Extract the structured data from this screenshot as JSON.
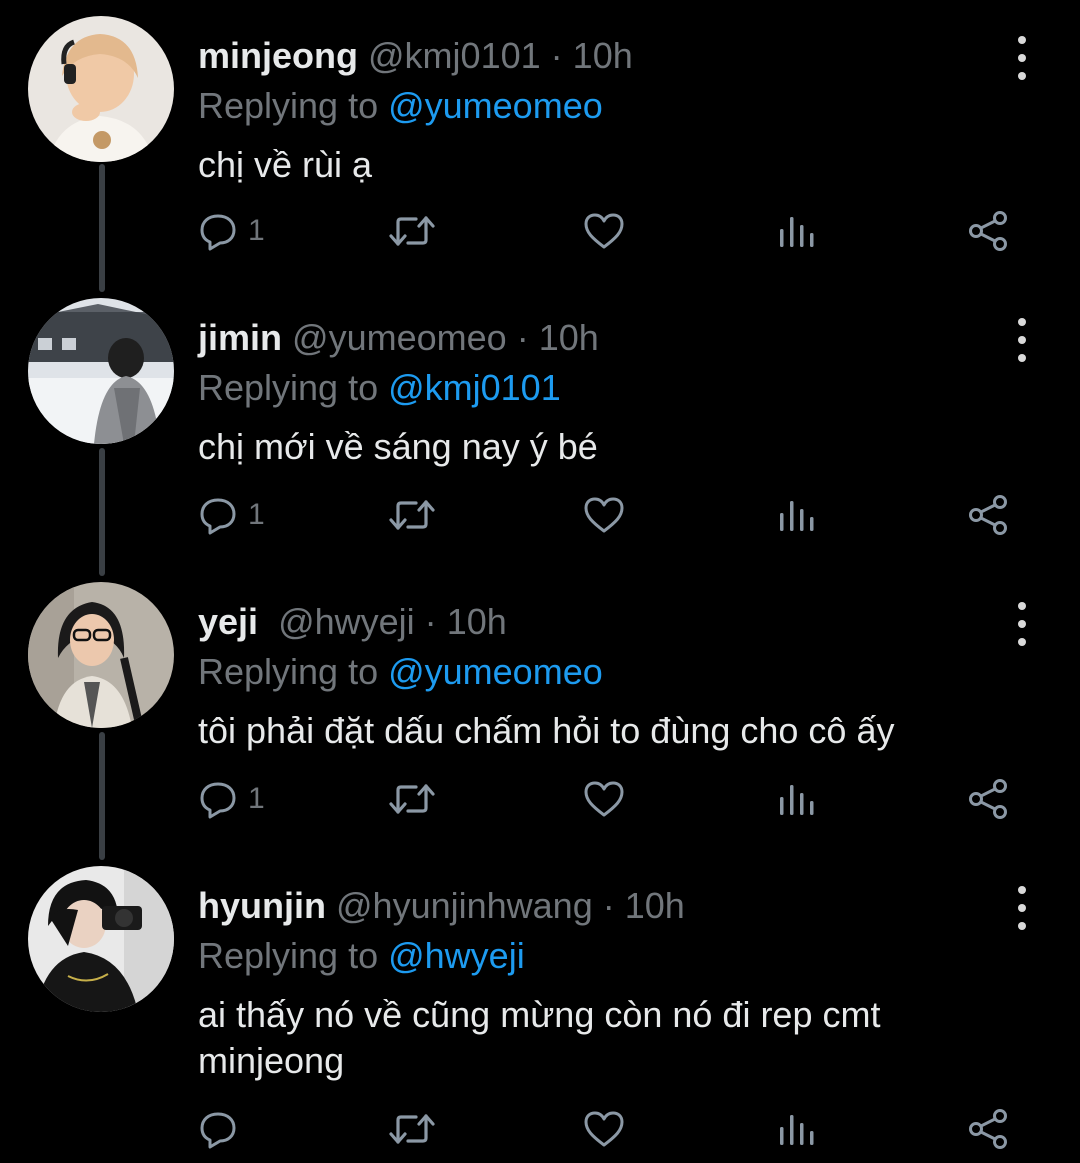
{
  "colors": {
    "background": "#000000",
    "text": "#e7e9ea",
    "muted": "#71767b",
    "accent": "#1d9bf0",
    "thread_line": "#3a3f44"
  },
  "tweets": [
    {
      "name": "minjeong",
      "handle": "@kmj0101",
      "sep": "·",
      "time": "10h",
      "replying_prefix": "Replying to ",
      "replying_to": "@yumeomeo",
      "text": "chị về rùi ạ",
      "reply_count": "1",
      "icons": [
        "reply-icon",
        "retweet-icon",
        "like-icon",
        "views-icon",
        "share-icon",
        "more-icon"
      ]
    },
    {
      "name": "jimin",
      "handle": "@yumeomeo",
      "sep": "·",
      "time": "10h",
      "replying_prefix": "Replying to ",
      "replying_to": "@kmj0101",
      "text": "chị mới về sáng nay ý bé",
      "reply_count": "1",
      "icons": [
        "reply-icon",
        "retweet-icon",
        "like-icon",
        "views-icon",
        "share-icon",
        "more-icon"
      ]
    },
    {
      "name": "yeji",
      "handle": "@hwyeji",
      "sep": "·",
      "time": "10h",
      "replying_prefix": "Replying to ",
      "replying_to": "@yumeomeo",
      "text": "tôi phải đặt dấu chấm hỏi to đùng cho cô ấy",
      "reply_count": "1",
      "icons": [
        "reply-icon",
        "retweet-icon",
        "like-icon",
        "views-icon",
        "share-icon",
        "more-icon"
      ]
    },
    {
      "name": "hyunjin",
      "handle": "@hyunjinhwang",
      "sep": "·",
      "time": "10h",
      "replying_prefix": "Replying to ",
      "replying_to": "@hwyeji",
      "text": "ai thấy nó về cũng mừng còn nó đi rep cmt minjeong",
      "reply_count": "",
      "icons": [
        "reply-icon",
        "retweet-icon",
        "like-icon",
        "views-icon",
        "share-icon",
        "more-icon"
      ]
    }
  ]
}
